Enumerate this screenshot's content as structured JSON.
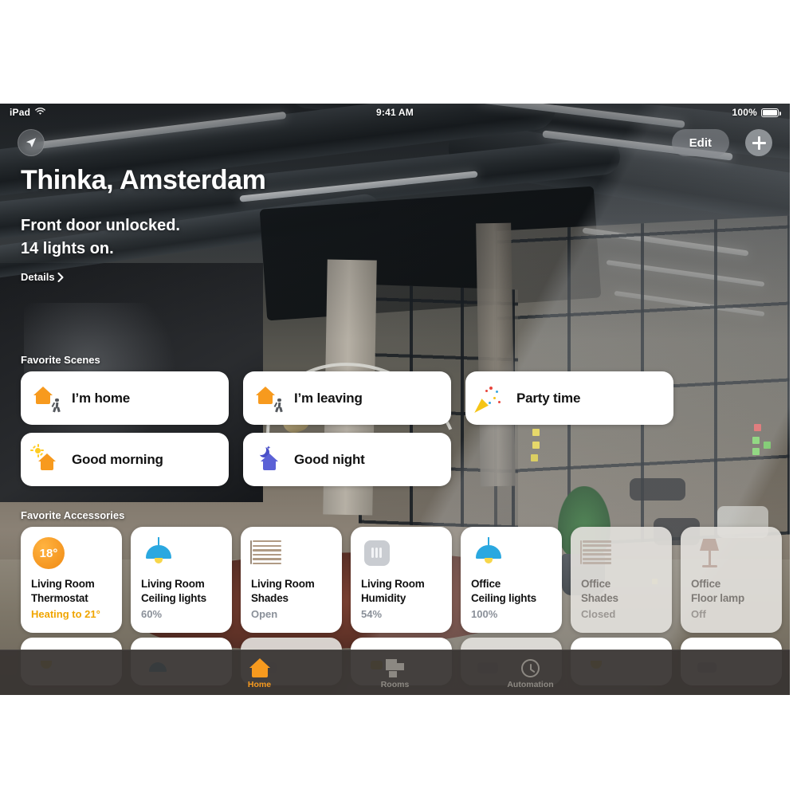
{
  "status_bar": {
    "device": "iPad",
    "wifi_icon": "wifi-icon",
    "time": "9:41 AM",
    "battery_percent": "100%",
    "battery_icon": "battery-full-icon"
  },
  "top_controls": {
    "location_icon": "location-arrow-icon",
    "edit_label": "Edit",
    "add_icon": "plus-icon"
  },
  "hero": {
    "home_name": "Thinka, Amsterdam",
    "status_line_1": "Front door unlocked.",
    "status_line_2": "14 lights on.",
    "details_label": "Details",
    "details_chevron": "chevron-right-icon"
  },
  "scenes": {
    "section_title": "Favorite Scenes",
    "items": [
      {
        "label": "I’m home",
        "icon": "house-person-icon"
      },
      {
        "label": "I’m leaving",
        "icon": "house-person-icon"
      },
      {
        "label": "Party time",
        "icon": "party-popper-icon"
      },
      {
        "label": "Good morning",
        "icon": "sun-house-icon"
      },
      {
        "label": "Good night",
        "icon": "moon-house-icon"
      }
    ]
  },
  "accessories": {
    "section_title": "Favorite Accessories",
    "items": [
      {
        "name": "Living Room\nThermostat",
        "state": "Heating to 21°",
        "icon": "thermostat-icon",
        "badge": "18°",
        "on": true,
        "state_style": "heat"
      },
      {
        "name": "Living Room\nCeiling lights",
        "state": "60%",
        "icon": "pendant-light-icon",
        "on": true
      },
      {
        "name": "Living Room\nShades",
        "state": "Open",
        "icon": "blinds-open-icon",
        "on": true
      },
      {
        "name": "Living Room\nHumidity",
        "state": "54%",
        "icon": "humidity-sensor-icon",
        "on": true
      },
      {
        "name": "Office\nCeiling lights",
        "state": "100%",
        "icon": "pendant-light-icon",
        "on": true
      },
      {
        "name": "Office\nShades",
        "state": "Closed",
        "icon": "blinds-closed-icon",
        "on": false
      },
      {
        "name": "Office\nFloor lamp",
        "state": "Off",
        "icon": "floor-lamp-icon",
        "on": false
      }
    ]
  },
  "tab_bar": {
    "tabs": [
      {
        "label": "Home",
        "icon": "home-icon",
        "active": true
      },
      {
        "label": "Rooms",
        "icon": "rooms-icon",
        "active": false
      },
      {
        "label": "Automation",
        "icon": "clock-icon",
        "active": false
      }
    ]
  },
  "colors": {
    "accent_orange": "#f79a1e",
    "light_blue": "#2aa8e0",
    "heat_orange": "#f0a500",
    "state_gray": "#8a9099",
    "tab_bar_bg": "#383432",
    "card_white": "#ffffff",
    "card_off": "#e2dfdb"
  }
}
